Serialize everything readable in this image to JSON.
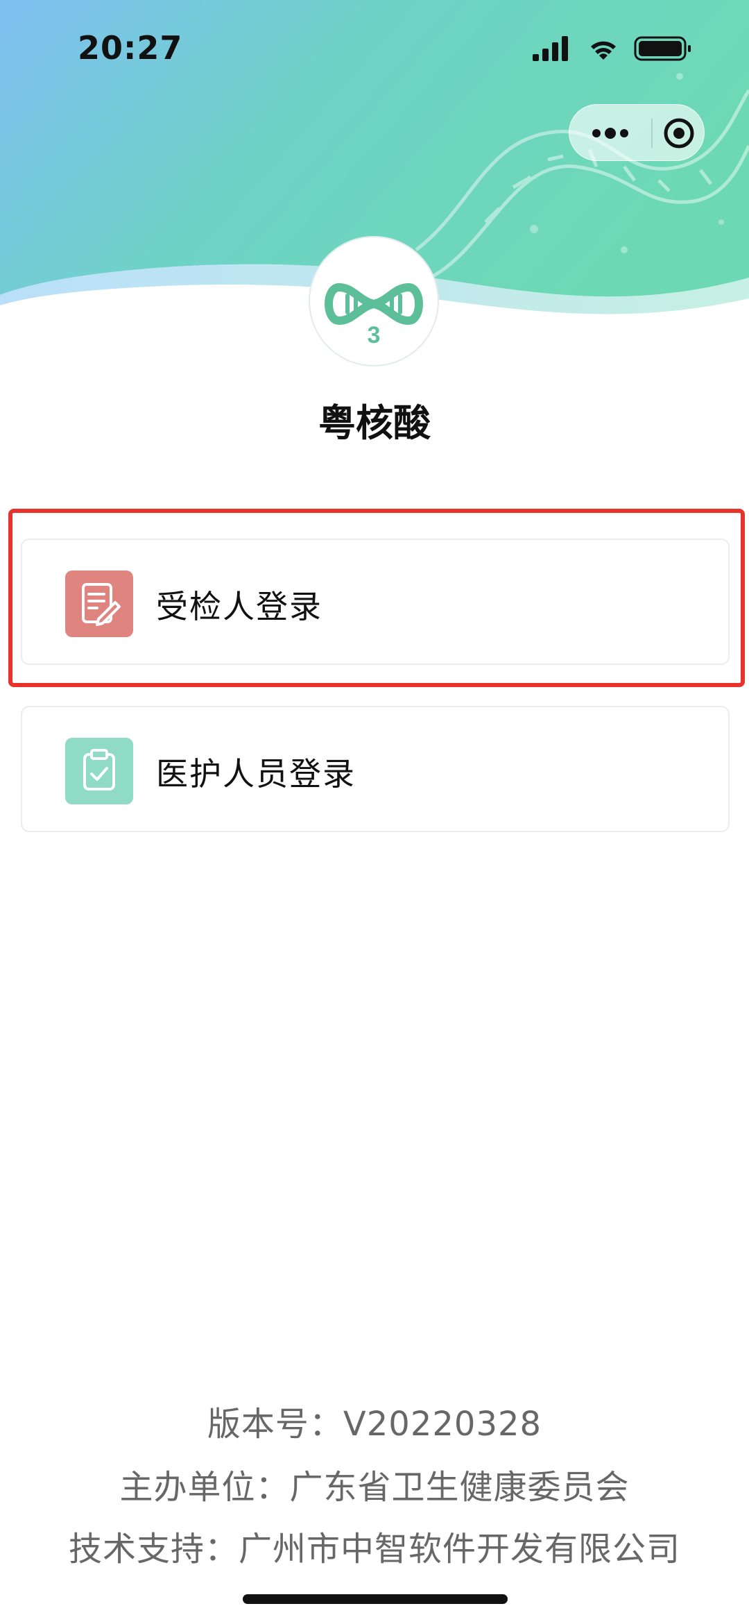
{
  "status_bar": {
    "time": "20:27",
    "icons": [
      "signal-icon",
      "wifi-icon",
      "battery-icon"
    ]
  },
  "capsule": {
    "more_icon": "more-icon",
    "close_icon": "target-icon"
  },
  "app": {
    "logo_text": "3",
    "title": "粤核酸",
    "brand_color": "#5cbf9a"
  },
  "login_options": [
    {
      "label": "受检人登录",
      "icon": "edit-document-icon",
      "color": "#df847f",
      "highlighted": true
    },
    {
      "label": "医护人员登录",
      "icon": "clipboard-check-icon",
      "color": "#8fdbc6",
      "highlighted": false
    }
  ],
  "highlight_color": "#e8322b",
  "footer": {
    "version": "版本号：V20220328",
    "host": "主办单位：广东省卫生健康委员会",
    "support": "技术支持：广州市中智软件开发有限公司"
  }
}
